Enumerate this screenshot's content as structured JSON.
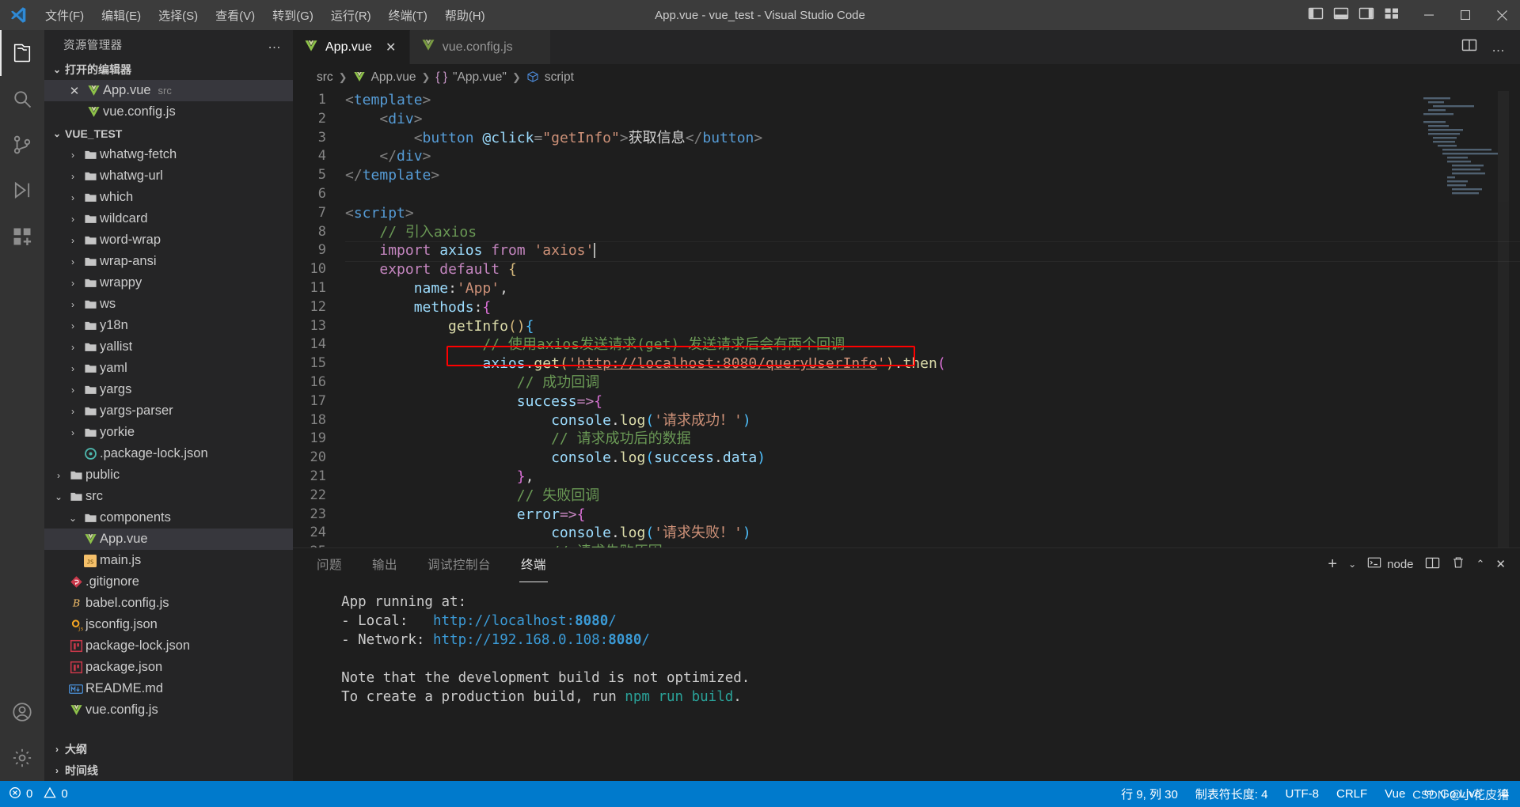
{
  "window": {
    "title": "App.vue - vue_test - Visual Studio Code",
    "menu": [
      "文件(F)",
      "编辑(E)",
      "选择(S)",
      "查看(V)",
      "转到(G)",
      "运行(R)",
      "终端(T)",
      "帮助(H)"
    ],
    "layout_icons": [
      "panel-left-icon",
      "panel-bottom-icon",
      "panel-right-icon",
      "customize-layout-icon"
    ],
    "controls": {
      "minimize": "minimize-icon",
      "maximize": "maximize-icon",
      "close": "close-icon"
    }
  },
  "activitybar": {
    "items": [
      {
        "name": "explorer",
        "icon": "files-icon",
        "active": true
      },
      {
        "name": "search",
        "icon": "search-icon",
        "active": false
      },
      {
        "name": "source-control",
        "icon": "source-control-icon",
        "active": false
      },
      {
        "name": "run-and-debug",
        "icon": "run-debug-icon",
        "active": false
      },
      {
        "name": "extensions",
        "icon": "extensions-icon",
        "active": false
      }
    ],
    "bottom": [
      {
        "name": "accounts",
        "icon": "account-icon"
      },
      {
        "name": "manage",
        "icon": "gear-icon"
      }
    ]
  },
  "sidebar": {
    "title": "资源管理器",
    "more_actions": "…",
    "open_editors": {
      "label": "打开的编辑器",
      "expanded": true,
      "items": [
        {
          "name": "App.vue",
          "sub": "src",
          "icon": "vue-icon",
          "selected": true,
          "closable": true
        },
        {
          "name": "vue.config.js",
          "sub": "",
          "icon": "vue-icon",
          "selected": false,
          "closable": false
        }
      ]
    },
    "project": {
      "label": "VUE_TEST",
      "expanded": true,
      "items": [
        {
          "name": "whatwg-fetch",
          "type": "folder",
          "depth": 2,
          "expanded": false
        },
        {
          "name": "whatwg-url",
          "type": "folder",
          "depth": 2,
          "expanded": false
        },
        {
          "name": "which",
          "type": "folder",
          "depth": 2,
          "expanded": false
        },
        {
          "name": "wildcard",
          "type": "folder",
          "depth": 2,
          "expanded": false
        },
        {
          "name": "word-wrap",
          "type": "folder",
          "depth": 2,
          "expanded": false
        },
        {
          "name": "wrap-ansi",
          "type": "folder",
          "depth": 2,
          "expanded": false
        },
        {
          "name": "wrappy",
          "type": "folder",
          "depth": 2,
          "expanded": false
        },
        {
          "name": "ws",
          "type": "folder",
          "depth": 2,
          "expanded": false
        },
        {
          "name": "y18n",
          "type": "folder",
          "depth": 2,
          "expanded": false
        },
        {
          "name": "yallist",
          "type": "folder",
          "depth": 2,
          "expanded": false
        },
        {
          "name": "yaml",
          "type": "folder",
          "depth": 2,
          "expanded": false
        },
        {
          "name": "yargs",
          "type": "folder",
          "depth": 2,
          "expanded": false
        },
        {
          "name": "yargs-parser",
          "type": "folder",
          "depth": 2,
          "expanded": false
        },
        {
          "name": "yorkie",
          "type": "folder",
          "depth": 2,
          "expanded": false
        },
        {
          "name": ".package-lock.json",
          "type": "json-icon",
          "depth": 2,
          "expanded": null
        },
        {
          "name": "public",
          "type": "folder",
          "depth": 1,
          "expanded": false
        },
        {
          "name": "src",
          "type": "folder",
          "depth": 1,
          "expanded": true
        },
        {
          "name": "components",
          "type": "folder",
          "depth": 2,
          "expanded": true
        },
        {
          "name": "App.vue",
          "type": "vue-icon",
          "depth": 2,
          "expanded": null,
          "selected": true
        },
        {
          "name": "main.js",
          "type": "js-icon",
          "depth": 2,
          "expanded": null
        },
        {
          "name": ".gitignore",
          "type": "git-icon",
          "depth": 1,
          "expanded": null
        },
        {
          "name": "babel.config.js",
          "type": "babel-icon",
          "depth": 1,
          "expanded": null
        },
        {
          "name": "jsconfig.json",
          "type": "jsconfig-icon",
          "depth": 1,
          "expanded": null
        },
        {
          "name": "package-lock.json",
          "type": "npm-icon",
          "depth": 1,
          "expanded": null
        },
        {
          "name": "package.json",
          "type": "npm-icon",
          "depth": 1,
          "expanded": null
        },
        {
          "name": "README.md",
          "type": "md-icon",
          "depth": 1,
          "expanded": null
        },
        {
          "name": "vue.config.js",
          "type": "vue-icon",
          "depth": 1,
          "expanded": null
        }
      ]
    },
    "footer_sections": [
      {
        "label": "大纲",
        "expanded": false
      },
      {
        "label": "时间线",
        "expanded": false
      }
    ]
  },
  "editor": {
    "tabs": [
      {
        "label": "App.vue",
        "icon": "vue-icon",
        "active": true,
        "close_icon": "close-icon"
      },
      {
        "label": "vue.config.js",
        "icon": "vue-icon",
        "active": false,
        "close_icon": "close-icon"
      }
    ],
    "tab_actions": [
      "split-editor-icon",
      "more-actions-icon"
    ],
    "breadcrumb": [
      {
        "text": "src",
        "icon": ""
      },
      {
        "text": "App.vue",
        "icon": "vue-icon"
      },
      {
        "text": "\"App.vue\"",
        "icon": "braces-icon"
      },
      {
        "text": "script",
        "icon": "symbol-module-icon"
      }
    ],
    "first_line": 1,
    "lines": [
      {
        "n": 1,
        "tokens": [
          [
            "t-brk",
            "<"
          ],
          [
            "t-tag",
            "template"
          ],
          [
            "t-brk",
            ">"
          ]
        ]
      },
      {
        "n": 2,
        "tokens": [
          [
            "t-txt",
            "    "
          ],
          [
            "t-brk",
            "<"
          ],
          [
            "t-tag",
            "div"
          ],
          [
            "t-brk",
            ">"
          ]
        ]
      },
      {
        "n": 3,
        "tokens": [
          [
            "t-txt",
            "        "
          ],
          [
            "t-brk",
            "<"
          ],
          [
            "t-tag",
            "button"
          ],
          [
            "t-txt",
            " "
          ],
          [
            "t-attr",
            "@click"
          ],
          [
            "t-brk",
            "="
          ],
          [
            "t-str",
            "\"getInfo\""
          ],
          [
            "t-brk",
            ">"
          ],
          [
            "t-txt",
            "获取信息"
          ],
          [
            "t-brk",
            "</"
          ],
          [
            "t-tag",
            "button"
          ],
          [
            "t-brk",
            ">"
          ]
        ]
      },
      {
        "n": 4,
        "tokens": [
          [
            "t-txt",
            "    "
          ],
          [
            "t-brk",
            "</"
          ],
          [
            "t-tag",
            "div"
          ],
          [
            "t-brk",
            ">"
          ]
        ]
      },
      {
        "n": 5,
        "tokens": [
          [
            "t-brk",
            "</"
          ],
          [
            "t-tag",
            "template"
          ],
          [
            "t-brk",
            ">"
          ]
        ]
      },
      {
        "n": 6,
        "tokens": []
      },
      {
        "n": 7,
        "tokens": [
          [
            "t-brk",
            "<"
          ],
          [
            "t-tag",
            "script"
          ],
          [
            "t-brk",
            ">"
          ]
        ]
      },
      {
        "n": 8,
        "tokens": [
          [
            "t-txt",
            "    "
          ],
          [
            "t-cmt",
            "// 引入axios"
          ]
        ]
      },
      {
        "n": 9,
        "tokens": [
          [
            "t-txt",
            "    "
          ],
          [
            "t-kw",
            "import"
          ],
          [
            "t-txt",
            " "
          ],
          [
            "t-id",
            "axios"
          ],
          [
            "t-txt",
            " "
          ],
          [
            "t-kw",
            "from"
          ],
          [
            "t-txt",
            " "
          ],
          [
            "t-str",
            "'axios'"
          ]
        ],
        "caret": true,
        "current": true
      },
      {
        "n": 10,
        "tokens": [
          [
            "t-txt",
            "    "
          ],
          [
            "t-kw",
            "export"
          ],
          [
            "t-txt",
            " "
          ],
          [
            "t-kw",
            "default"
          ],
          [
            "t-txt",
            " "
          ],
          [
            "t-yellow",
            "{"
          ]
        ]
      },
      {
        "n": 11,
        "tokens": [
          [
            "t-txt",
            "        "
          ],
          [
            "t-id",
            "name"
          ],
          [
            "t-txt",
            ":"
          ],
          [
            "t-str",
            "'App'"
          ],
          [
            "t-txt",
            ","
          ]
        ]
      },
      {
        "n": 12,
        "tokens": [
          [
            "t-txt",
            "        "
          ],
          [
            "t-id",
            "methods"
          ],
          [
            "t-txt",
            ":"
          ],
          [
            "t-pink",
            "{"
          ]
        ]
      },
      {
        "n": 13,
        "tokens": [
          [
            "t-txt",
            "            "
          ],
          [
            "t-prop",
            "getInfo"
          ],
          [
            "t-yellow",
            "("
          ],
          [
            "t-yellow",
            ")"
          ],
          [
            "t-blue2",
            "{"
          ]
        ]
      },
      {
        "n": 14,
        "tokens": [
          [
            "t-txt",
            "                "
          ],
          [
            "t-cmt",
            "// 使用axios发送请求(get) 发送请求后会有两个回调"
          ]
        ]
      },
      {
        "n": 15,
        "tokens": [
          [
            "t-txt",
            "                "
          ],
          [
            "t-id",
            "axios"
          ],
          [
            "t-txt",
            "."
          ],
          [
            "t-prop",
            "get"
          ],
          [
            "t-yellow",
            "("
          ],
          [
            "t-str",
            "'"
          ],
          [
            "t-str under",
            "http://localhost:8080/queryUserInfo"
          ],
          [
            "t-str",
            "'"
          ],
          [
            "t-yellow",
            ")"
          ],
          [
            "t-txt",
            "."
          ],
          [
            "t-prop",
            "then"
          ],
          [
            "t-pink",
            "("
          ]
        ]
      },
      {
        "n": 16,
        "tokens": [
          [
            "t-txt",
            "                    "
          ],
          [
            "t-cmt",
            "// 成功回调"
          ]
        ]
      },
      {
        "n": 17,
        "tokens": [
          [
            "t-txt",
            "                    "
          ],
          [
            "t-id",
            "success"
          ],
          [
            "t-kw",
            "=>"
          ],
          [
            "t-pink",
            "{"
          ]
        ]
      },
      {
        "n": 18,
        "tokens": [
          [
            "t-txt",
            "                        "
          ],
          [
            "t-id",
            "console"
          ],
          [
            "t-txt",
            "."
          ],
          [
            "t-prop",
            "log"
          ],
          [
            "t-blue2",
            "("
          ],
          [
            "t-str",
            "'请求成功！'"
          ],
          [
            "t-blue2",
            ")"
          ]
        ]
      },
      {
        "n": 19,
        "tokens": [
          [
            "t-txt",
            "                        "
          ],
          [
            "t-cmt",
            "// 请求成功后的数据"
          ]
        ]
      },
      {
        "n": 20,
        "tokens": [
          [
            "t-txt",
            "                        "
          ],
          [
            "t-id",
            "console"
          ],
          [
            "t-txt",
            "."
          ],
          [
            "t-prop",
            "log"
          ],
          [
            "t-blue2",
            "("
          ],
          [
            "t-id",
            "success"
          ],
          [
            "t-txt",
            "."
          ],
          [
            "t-id",
            "data"
          ],
          [
            "t-blue2",
            ")"
          ]
        ]
      },
      {
        "n": 21,
        "tokens": [
          [
            "t-txt",
            "                    "
          ],
          [
            "t-pink",
            "}"
          ],
          [
            "t-txt",
            ","
          ]
        ]
      },
      {
        "n": 22,
        "tokens": [
          [
            "t-txt",
            "                    "
          ],
          [
            "t-cmt",
            "// 失败回调"
          ]
        ]
      },
      {
        "n": 23,
        "tokens": [
          [
            "t-txt",
            "                    "
          ],
          [
            "t-id",
            "error"
          ],
          [
            "t-kw",
            "=>"
          ],
          [
            "t-pink",
            "{"
          ]
        ]
      },
      {
        "n": 24,
        "tokens": [
          [
            "t-txt",
            "                        "
          ],
          [
            "t-id",
            "console"
          ],
          [
            "t-txt",
            "."
          ],
          [
            "t-prop",
            "log"
          ],
          [
            "t-blue2",
            "("
          ],
          [
            "t-str",
            "'请求失败！'"
          ],
          [
            "t-blue2",
            ")"
          ]
        ]
      },
      {
        "n": 25,
        "tokens": [
          [
            "t-txt",
            "                        "
          ],
          [
            "t-cmt",
            "// 请求失败原因"
          ]
        ]
      }
    ],
    "highlight_box": {
      "line": 15,
      "label": "axios-get-url-highlight",
      "color": "#ff0000"
    }
  },
  "panel": {
    "tabs": [
      {
        "label": "问题",
        "active": false
      },
      {
        "label": "输出",
        "active": false
      },
      {
        "label": "调试控制台",
        "active": false
      },
      {
        "label": "终端",
        "active": true
      }
    ],
    "actions": {
      "new_terminal": "+",
      "new_terminal_dropdown": "chevron-down-icon",
      "shell_label": "node",
      "shell_icon": "terminal-icon",
      "split_icon": "split-terminal-icon",
      "kill_icon": "trash-icon",
      "maximize_icon": "chevron-up-icon",
      "close_icon": "close-icon"
    },
    "terminal_lines": [
      [
        [
          "plain",
          "  App running at:"
        ]
      ],
      [
        [
          "plain",
          "  - Local:   "
        ],
        [
          "link",
          "http://localhost:"
        ],
        [
          "num",
          "8080"
        ],
        [
          "link",
          "/"
        ]
      ],
      [
        [
          "plain",
          "  - Network: "
        ],
        [
          "link",
          "http://192.168.0.108:"
        ],
        [
          "num",
          "8080"
        ],
        [
          "link",
          "/"
        ]
      ],
      [
        [
          "plain",
          ""
        ]
      ],
      [
        [
          "plain",
          "  Note that the development build is not optimized."
        ]
      ],
      [
        [
          "plain",
          "  To create a production build, run "
        ],
        [
          "cmd",
          "npm run build"
        ],
        [
          "plain",
          "."
        ]
      ]
    ]
  },
  "statusbar": {
    "left": [
      {
        "name": "errors-warnings",
        "icon": "error-icon",
        "text": "0",
        "icon2": "warning-icon",
        "text2": "0"
      }
    ],
    "right": [
      {
        "name": "line-column",
        "text": "行 9, 列 30"
      },
      {
        "name": "indentation",
        "text": "制表符长度: 4"
      },
      {
        "name": "encoding",
        "text": "UTF-8"
      },
      {
        "name": "eol",
        "text": "CRLF"
      },
      {
        "name": "language-mode",
        "text": "Vue"
      },
      {
        "name": "go-live",
        "text": "Go Live",
        "icon": "broadcast-icon"
      },
      {
        "name": "notifications",
        "text": "",
        "icon": "bell-icon"
      }
    ],
    "accent_color": "#007acc",
    "watermark": "CSDN @小花皮猪"
  }
}
